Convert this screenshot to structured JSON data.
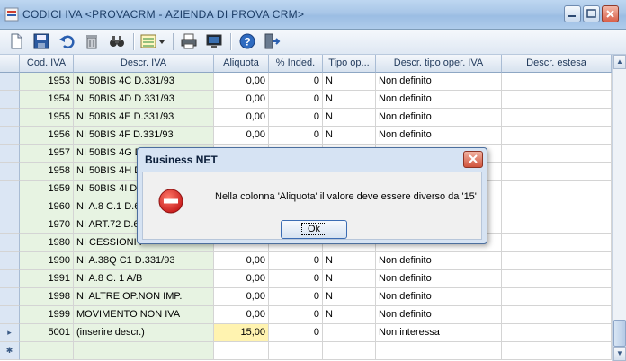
{
  "window": {
    "title": "CODICI IVA  <PROVACRM - AZIENDA DI PROVA CRM>"
  },
  "toolbar": {
    "tools": [
      "new-icon",
      "save-icon",
      "undo-icon",
      "delete-icon",
      "find-icon",
      "layout-icon",
      "print-icon",
      "preview-icon",
      "help-icon",
      "exit-icon"
    ]
  },
  "grid": {
    "columns": [
      "Cod. IVA",
      "Descr. IVA",
      "Aliquota",
      "% Inded.",
      "Tipo op...",
      "Descr. tipo oper. IVA",
      "Descr. estesa"
    ],
    "rows": [
      {
        "cod": "1953",
        "descr": "NI 50BIS 4C D.331/93",
        "aliquota": "0,00",
        "inded": "0",
        "tipo": "N",
        "descr_tipo": "Non definito"
      },
      {
        "cod": "1954",
        "descr": "NI 50BIS 4D D.331/93",
        "aliquota": "0,00",
        "inded": "0",
        "tipo": "N",
        "descr_tipo": "Non definito"
      },
      {
        "cod": "1955",
        "descr": "NI 50BIS 4E D.331/93",
        "aliquota": "0,00",
        "inded": "0",
        "tipo": "N",
        "descr_tipo": "Non definito"
      },
      {
        "cod": "1956",
        "descr": "NI 50BIS 4F D.331/93",
        "aliquota": "0,00",
        "inded": "0",
        "tipo": "N",
        "descr_tipo": "Non definito"
      },
      {
        "cod": "1957",
        "descr": "NI 50BIS 4G D",
        "aliquota": "",
        "inded": "",
        "tipo": "",
        "descr_tipo": ""
      },
      {
        "cod": "1958",
        "descr": "NI 50BIS 4H D",
        "aliquota": "",
        "inded": "",
        "tipo": "",
        "descr_tipo": ""
      },
      {
        "cod": "1959",
        "descr": "NI 50BIS 4I D.",
        "aliquota": "",
        "inded": "",
        "tipo": "",
        "descr_tipo": ""
      },
      {
        "cod": "1960",
        "descr": "NI A.8 C.1 D.6",
        "aliquota": "",
        "inded": "",
        "tipo": "",
        "descr_tipo": ""
      },
      {
        "cod": "1970",
        "descr": "NI ART.72 D.6",
        "aliquota": "",
        "inded": "",
        "tipo": "",
        "descr_tipo": ""
      },
      {
        "cod": "1980",
        "descr": "NI CESSIONI I",
        "aliquota": "",
        "inded": "",
        "tipo": "",
        "descr_tipo": ""
      },
      {
        "cod": "1990",
        "descr": "NI A.38Q C1 D.331/93",
        "aliquota": "0,00",
        "inded": "0",
        "tipo": "N",
        "descr_tipo": "Non definito"
      },
      {
        "cod": "1991",
        "descr": "NI A.8 C. 1 A/B",
        "aliquota": "0,00",
        "inded": "0",
        "tipo": "N",
        "descr_tipo": "Non definito"
      },
      {
        "cod": "1998",
        "descr": "NI ALTRE OP.NON IMP.",
        "aliquota": "0,00",
        "inded": "0",
        "tipo": "N",
        "descr_tipo": "Non definito"
      },
      {
        "cod": "1999",
        "descr": "MOVIMENTO NON IVA",
        "aliquota": "0,00",
        "inded": "0",
        "tipo": "N",
        "descr_tipo": "Non definito"
      },
      {
        "cod": "5001",
        "descr": "(inserire descr.)",
        "aliquota": "15,00",
        "inded": "0",
        "tipo": "",
        "descr_tipo": "Non interessa"
      }
    ],
    "current_row_marker": "▸",
    "new_row_marker": "✱"
  },
  "dialog": {
    "title": "Business NET",
    "message": "Nella colonna 'Aliquota' il valore deve essere diverso da '15'",
    "ok_label": "Ok"
  },
  "colors": {
    "titlebar": "#a8c6e7",
    "code_column": "#e7f3e2",
    "edited_cell": "#fff3b0",
    "error_icon": "#d32b2b"
  }
}
